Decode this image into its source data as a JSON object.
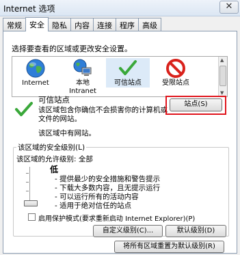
{
  "window": {
    "title": "Internet 选项",
    "close_label": "✕"
  },
  "tabs": [
    "常规",
    "安全",
    "隐私",
    "内容",
    "连接",
    "程序",
    "高级"
  ],
  "active_tab": 1,
  "security": {
    "prompt": "选择要查看的区域或更改安全设置。",
    "zones": [
      {
        "label": "Internet",
        "icon": "globe-icon"
      },
      {
        "label": "本地\nIntranet",
        "icon": "intranet-icon"
      },
      {
        "label": "可信站点",
        "icon": "checkmark-icon"
      },
      {
        "label": "受限站点",
        "icon": "restricted-icon"
      }
    ],
    "selected_zone": {
      "name": "可信站点",
      "description_line1": "该区域包含你确信不会损害你的计算机或",
      "description_line2": "文件的网站。",
      "status": "该区域中有网站。"
    },
    "sites_button": "站点(S)",
    "level_group": {
      "legend": "该区域的安全级别(L)",
      "allowed_levels": "该区域的允许级别: 全部",
      "current_level": "低",
      "bullets": [
        "- 提供最少的安全措施和警告提示",
        "- 下载大多数内容，且无提示运行",
        "- 可以运行所有的活动内容",
        "- 适用于绝对信任的站点"
      ]
    },
    "protected_mode": {
      "label": "启用保护模式(要求重新启动 Internet Explorer)(P)",
      "checked": false
    },
    "custom_level_button": "自定义级别(C)...",
    "default_level_button": "默认级别(D)",
    "reset_all_button": "将所有区域重置为默认级别(R)"
  },
  "colors": {
    "highlight_box": "#e0141c",
    "check_green": "#3aa83a",
    "restricted_red": "#d9221c"
  }
}
